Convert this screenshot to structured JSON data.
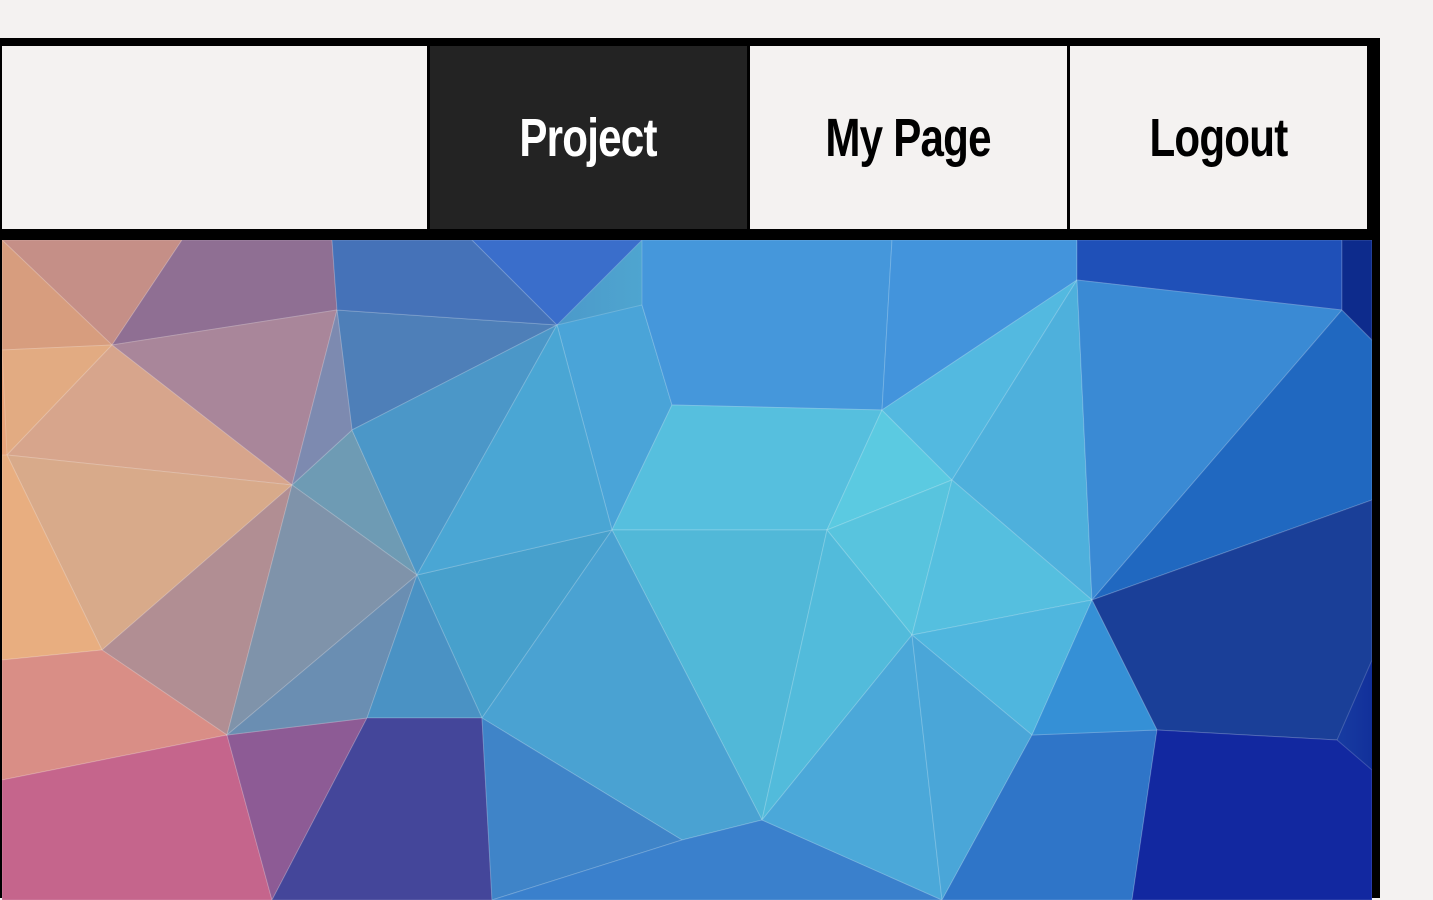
{
  "nav": {
    "items": [
      {
        "label": "Project",
        "active": true
      },
      {
        "label": "My Page",
        "active": false
      },
      {
        "label": "Logout",
        "active": false
      }
    ]
  },
  "hero": {
    "description_icon": "low-poly-gradient-background"
  },
  "colors": {
    "active_bg": "#232323",
    "nav_bg": "#f4f2f1",
    "border": "#000000"
  }
}
